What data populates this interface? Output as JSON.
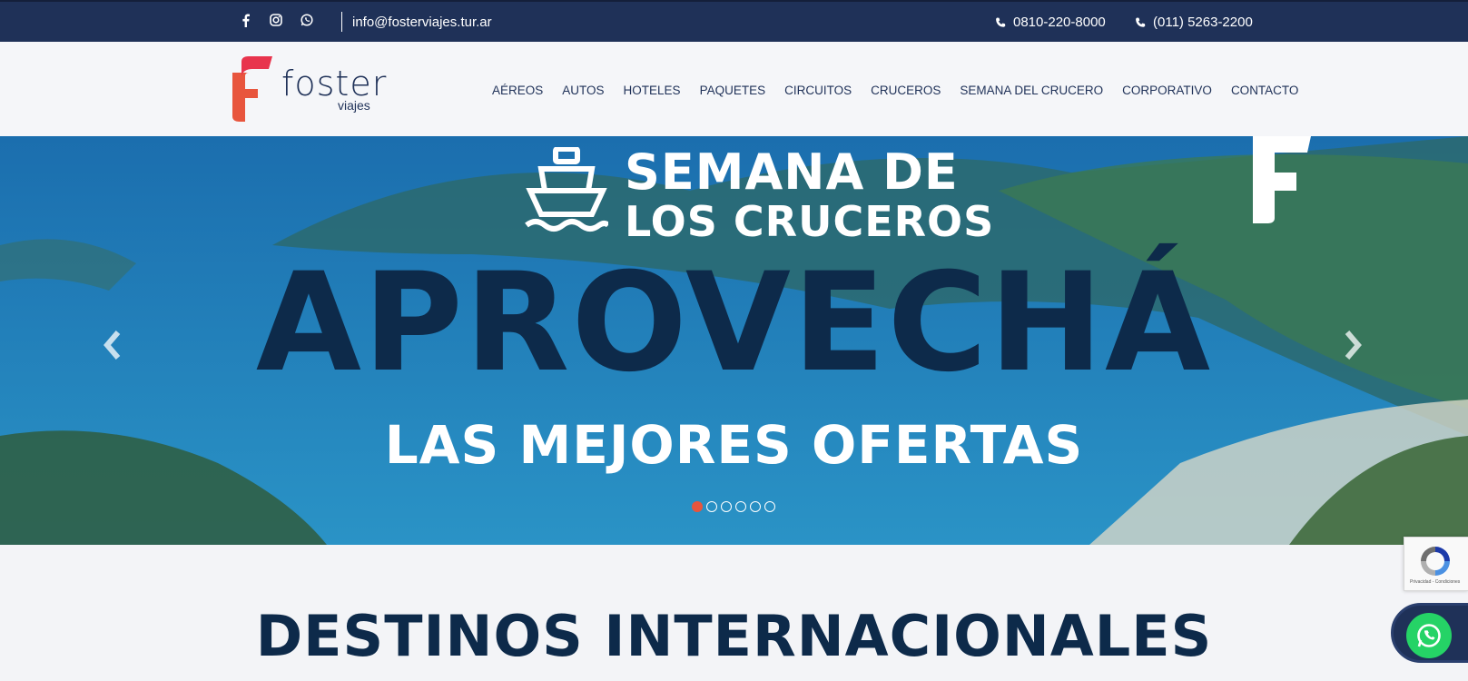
{
  "topbar": {
    "social_icons": [
      "facebook-icon",
      "instagram-icon",
      "whatsapp-icon"
    ],
    "email": "info@fosterviajes.tur.ar",
    "phone1": "0810-220-8000",
    "phone2": "(011) 5263-2200"
  },
  "header": {
    "logo_text": "foster",
    "logo_sub": "viajes",
    "nav": [
      "AÉREOS",
      "AUTOS",
      "HOTELES",
      "PAQUETES",
      "CIRCUITOS",
      "CRUCEROS",
      "SEMANA DEL CRUCERO",
      "CORPORATIVO",
      "CONTACTO"
    ]
  },
  "hero": {
    "title_line1": "SEMANA DE",
    "title_line2": "LOS CRUCEROS",
    "headline": "APROVECHÁ",
    "subheadline": "LAS MEJORES OFERTAS",
    "slide_count": 6,
    "active_slide": 1
  },
  "section": {
    "title": "DESTINOS INTERNACIONALES"
  },
  "recaptcha": {
    "text": "Privacidad - Condiciones"
  },
  "colors": {
    "navy": "#1f3158",
    "dark_navy": "#0d2a4a",
    "brand_red": "#e8553d",
    "whatsapp": "#25d366"
  }
}
